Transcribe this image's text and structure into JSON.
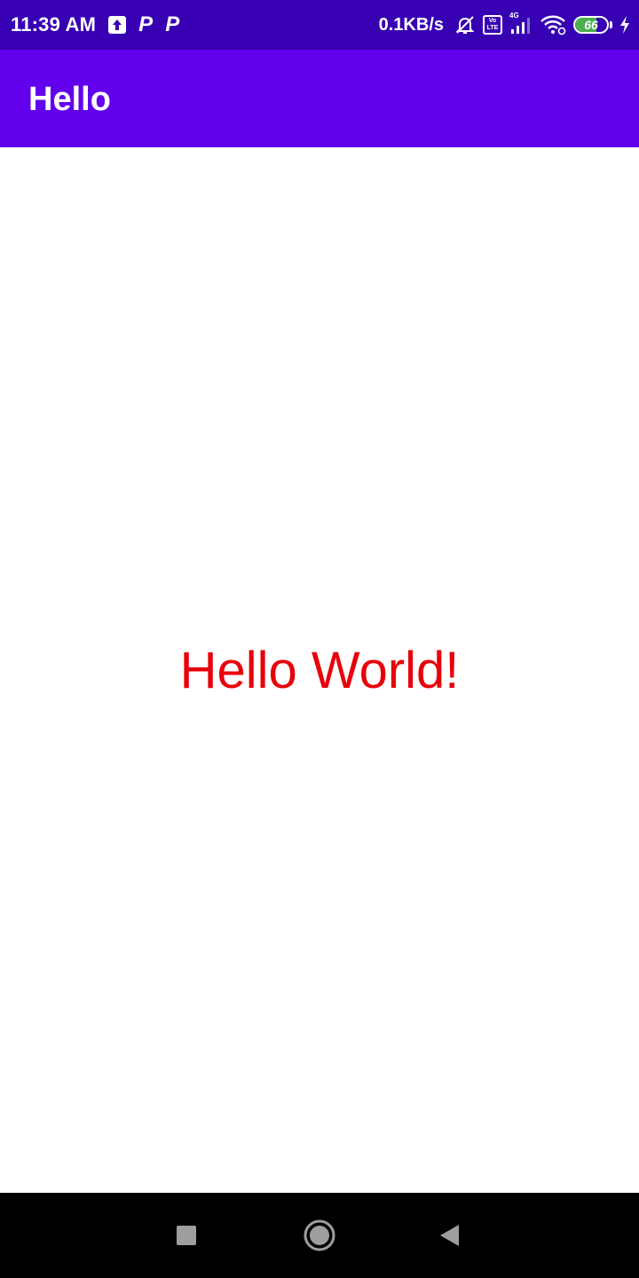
{
  "status_bar": {
    "time": "11:39 AM",
    "net_speed": "0.1KB/s",
    "notifications": [
      "upload-icon",
      "p-app-icon",
      "p-app-icon"
    ],
    "p_glyph": "P",
    "volte": {
      "top": "Vo",
      "bottom": "LTE"
    },
    "network_type": "4G",
    "battery_level": "66",
    "battery_fraction": 0.66,
    "colors": {
      "background": "#3700B3",
      "battery_fill": "#4CAF50"
    }
  },
  "app_bar": {
    "title": "Hello",
    "color": "#6200EE"
  },
  "main": {
    "message": "Hello World!",
    "message_color": "#E8000B"
  },
  "nav_bar": {
    "buttons": [
      "recents-square-icon",
      "home-circle-icon",
      "back-triangle-icon"
    ]
  }
}
